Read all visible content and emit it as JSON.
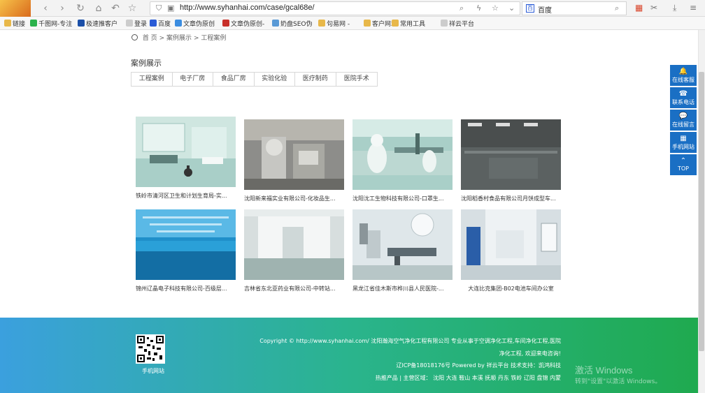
{
  "browser": {
    "url": "http://www.syhanhai.com/case/gcal68e/",
    "search_engine": "百度"
  },
  "bookmarks": [
    {
      "label": "链接",
      "color": "#e8b84a"
    },
    {
      "label": "千图网-专注",
      "color": "#2bb24c"
    },
    {
      "label": "极速推客户",
      "color": "#1b4fa8"
    },
    {
      "label": "登录",
      "color": "#cccccc"
    },
    {
      "label": "百度",
      "color": "#2a5bd6"
    },
    {
      "label": "文章伪原创",
      "color": "#3c8de0"
    },
    {
      "label": "文章伪原创-",
      "color": "#c8302a"
    },
    {
      "label": "奶盘SEO伪",
      "color": "#5a9ad6"
    },
    {
      "label": "句易网 -",
      "color": "#e8b84a"
    },
    {
      "label": "客户网站",
      "color": "#e8b84a"
    },
    {
      "label": "常用工具",
      "color": "#e8b84a"
    },
    {
      "label": "祥云平台",
      "color": "#cccccc"
    }
  ],
  "breadcrumb": {
    "home": "首 页",
    "sep1": ">",
    "level1": "案例展示",
    "sep2": ">",
    "level2": "工程案例"
  },
  "section_title": "案例展示",
  "tabs": [
    "工程案例",
    "电子厂房",
    "食品厂房",
    "实验化验",
    "医疗制药",
    "医院手术"
  ],
  "cases": [
    {
      "caption": "铁岭市清河区卫生和计划生育局-实...",
      "theme": "lab"
    },
    {
      "caption": "沈阳新来福实业有限公司-化妆品生...",
      "theme": "machine"
    },
    {
      "caption": "沈阳沈工生物科技有限公司-口罩生...",
      "theme": "production"
    },
    {
      "caption": "沈阳稻香村食品有限公司月饼成型车...",
      "theme": "hall"
    },
    {
      "caption": "锦州辽晶电子科技有限公司-百级层...",
      "theme": "blue"
    },
    {
      "caption": "吉林省东北亚药业有限公司-中转站...",
      "theme": "room"
    },
    {
      "caption": "黑龙江省佳木斯市桦川县人民医院-...",
      "theme": "surgery"
    },
    {
      "caption": "大连比克集团-B02电池车间办公室",
      "theme": "corridor"
    }
  ],
  "footer": {
    "line1": "Copyright © http://www.syhanhai.com/ 沈阳瀚海空气净化工程有限公司 专业从事于空调净化工程,车间净化工程,医院",
    "line2": "净化工程, 欢迎来电咨询!",
    "line3": "辽ICP备18018176号  Powered by 祥云平台  技术支持：凯鸿科技",
    "line4": "热推产品 | 主营区域： 沈阳 大连 鞍山 本溪 抚顺 丹东 铁岭 辽阳 盘锦 内蒙",
    "qr_label": "手机网站"
  },
  "watermark": {
    "line1": "激活 Windows",
    "line2": "转到\"设置\"以激活 Windows。"
  },
  "side_panel": [
    {
      "label": "在线客服",
      "icon": "bell-icon",
      "glyph": "🔔"
    },
    {
      "label": "联系电话",
      "icon": "phone-icon",
      "glyph": "☎"
    },
    {
      "label": "在线留言",
      "icon": "chat-icon",
      "glyph": "💬"
    },
    {
      "label": "手机网站",
      "icon": "qr-icon",
      "glyph": "▦"
    },
    {
      "label": "TOP",
      "icon": "arrow-up-icon",
      "glyph": "⌃"
    }
  ],
  "colors": {
    "accent": "#1a6fc4",
    "footer_start": "#3ba0de",
    "footer_end": "#1faa4f"
  }
}
